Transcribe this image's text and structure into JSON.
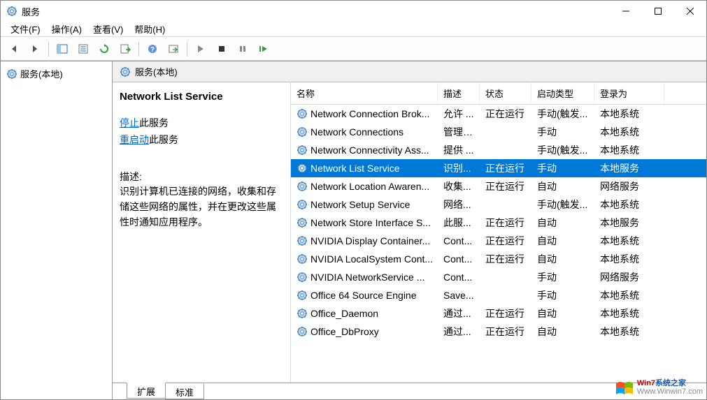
{
  "window": {
    "title": "服务"
  },
  "menu": {
    "items": [
      "文件(F)",
      "操作(A)",
      "查看(V)",
      "帮助(H)"
    ]
  },
  "tree": {
    "root": "服务(本地)"
  },
  "contentHeader": "服务(本地)",
  "detail": {
    "title": "Network List Service",
    "stopLink": "停止",
    "stopSuffix": "此服务",
    "restartLink": "重启动",
    "restartSuffix": "此服务",
    "descLabel": "描述:",
    "descText": "识别计算机已连接的网络，收集和存储这些网络的属性，并在更改这些属性时通知应用程序。"
  },
  "columns": {
    "name": "名称",
    "desc": "描述",
    "status": "状态",
    "start": "启动类型",
    "logon": "登录为"
  },
  "rows": [
    {
      "name": "Network Connection Brok...",
      "desc": "允许 ...",
      "status": "正在运行",
      "start": "手动(触发...",
      "logon": "本地系统",
      "selected": false
    },
    {
      "name": "Network Connections",
      "desc": "管理\"...",
      "status": "",
      "start": "手动",
      "logon": "本地系统",
      "selected": false
    },
    {
      "name": "Network Connectivity Ass...",
      "desc": "提供 ...",
      "status": "",
      "start": "手动(触发...",
      "logon": "本地系统",
      "selected": false
    },
    {
      "name": "Network List Service",
      "desc": "识别...",
      "status": "正在运行",
      "start": "手动",
      "logon": "本地服务",
      "selected": true
    },
    {
      "name": "Network Location Awaren...",
      "desc": "收集...",
      "status": "正在运行",
      "start": "自动",
      "logon": "网络服务",
      "selected": false
    },
    {
      "name": "Network Setup Service",
      "desc": "网络...",
      "status": "",
      "start": "手动(触发...",
      "logon": "本地系统",
      "selected": false
    },
    {
      "name": "Network Store Interface S...",
      "desc": "此服...",
      "status": "正在运行",
      "start": "自动",
      "logon": "本地服务",
      "selected": false
    },
    {
      "name": "NVIDIA Display Container...",
      "desc": "Cont...",
      "status": "正在运行",
      "start": "自动",
      "logon": "本地系统",
      "selected": false
    },
    {
      "name": "NVIDIA LocalSystem Cont...",
      "desc": "Cont...",
      "status": "正在运行",
      "start": "自动",
      "logon": "本地系统",
      "selected": false
    },
    {
      "name": "NVIDIA NetworkService ...",
      "desc": "Cont...",
      "status": "",
      "start": "手动",
      "logon": "网络服务",
      "selected": false
    },
    {
      "name": "Office 64 Source Engine",
      "desc": "Save...",
      "status": "",
      "start": "手动",
      "logon": "本地系统",
      "selected": false
    },
    {
      "name": "Office_Daemon",
      "desc": "通过...",
      "status": "正在运行",
      "start": "自动",
      "logon": "本地系统",
      "selected": false
    },
    {
      "name": "Office_DbProxy",
      "desc": "通过...",
      "status": "正在运行",
      "start": "自动",
      "logon": "本地系统",
      "selected": false
    }
  ],
  "tabs": {
    "extended": "扩展",
    "standard": "标准"
  },
  "watermark": {
    "brand": "Win7系统之家",
    "url": "Www.Winwin7.com"
  }
}
